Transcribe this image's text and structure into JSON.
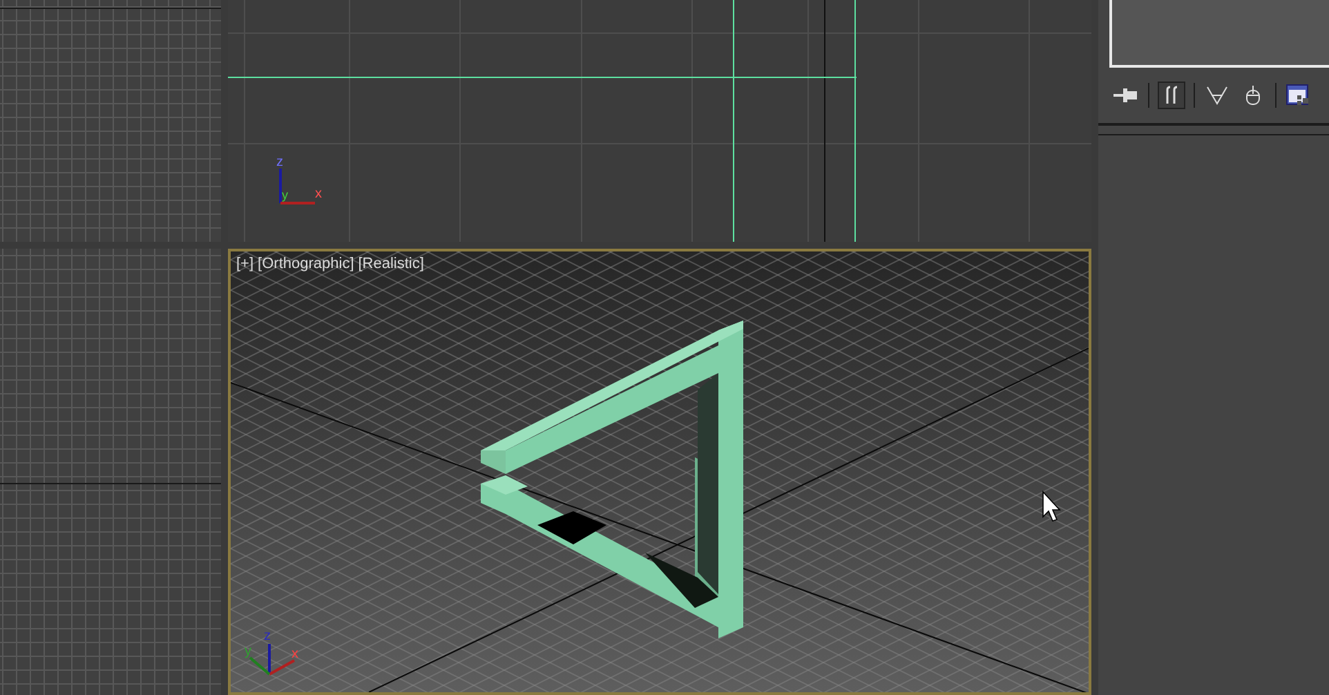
{
  "side_viewports": [
    {
      "kind": "grid"
    },
    {
      "kind": "grid"
    }
  ],
  "top_viewport": {
    "gizmo": {
      "z": "z",
      "y": "y",
      "x": "x"
    }
  },
  "main_viewport": {
    "active": true,
    "labels": [
      "[+]",
      "[Orthographic]",
      "[Realistic]"
    ],
    "gizmo": {
      "z": "z",
      "y": "y",
      "x": "x"
    }
  },
  "command_panel": {
    "toolbar": [
      {
        "kind": "pin",
        "selected": false
      },
      {
        "kind": "separator"
      },
      {
        "kind": "bars",
        "selected": true
      },
      {
        "kind": "separator"
      },
      {
        "kind": "funnel",
        "selected": false
      },
      {
        "kind": "mouse",
        "selected": false
      },
      {
        "kind": "separator"
      },
      {
        "kind": "window",
        "selected": false
      }
    ]
  }
}
